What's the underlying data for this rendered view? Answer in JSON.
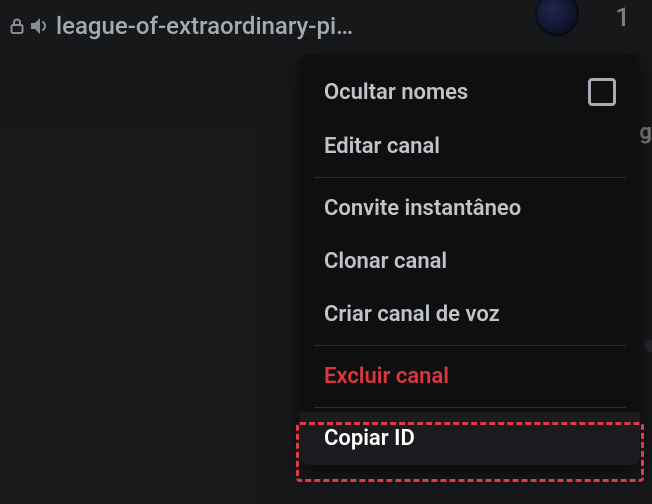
{
  "channel": {
    "name": "league-of-extraordinary-pi…"
  },
  "topRight": {
    "count": "1"
  },
  "sidePeek": "g",
  "menu": {
    "hideNames": "Ocultar nomes",
    "editChannel": "Editar canal",
    "instantInvite": "Convite instantâneo",
    "cloneChannel": "Clonar canal",
    "createVoice": "Criar canal de voz",
    "deleteChannel": "Excluir canal",
    "copyId": "Copiar ID"
  }
}
